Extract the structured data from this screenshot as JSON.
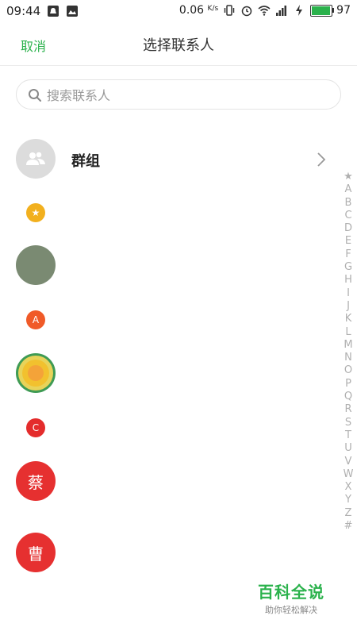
{
  "status_bar": {
    "time": "09:44",
    "net_speed": "0.06",
    "net_unit": "K/s",
    "battery": "97",
    "battery_fraction": 0.97,
    "battery_color": "#2bb24c"
  },
  "header": {
    "cancel_label": "取消",
    "title": "选择联系人"
  },
  "search": {
    "placeholder": "搜索联系人"
  },
  "groups_row": {
    "label": "群组",
    "icon": "people-icon",
    "chevron_icon": "chevron-right-icon"
  },
  "sections": [
    {
      "key": "starred",
      "badge": "★",
      "badge_color": "#f2b01e"
    },
    {
      "key": "A",
      "badge": "A",
      "badge_color": "#f05a28"
    },
    {
      "key": "C",
      "badge": "C",
      "badge_color": "#e42c2c"
    }
  ],
  "contacts": [
    {
      "section": "starred",
      "avatar_type": "photo-pixelated",
      "avatar_text": ""
    },
    {
      "section": "A",
      "avatar_type": "lion-icon",
      "avatar_text": ""
    },
    {
      "section": "C",
      "avatar_type": "letter",
      "avatar_text": "蔡",
      "avatar_color": "#e63030"
    },
    {
      "section": "C",
      "avatar_type": "letter",
      "avatar_text": "曹",
      "avatar_color": "#e63030"
    }
  ],
  "alpha_index": [
    "★",
    "A",
    "B",
    "C",
    "D",
    "E",
    "F",
    "G",
    "H",
    "I",
    "J",
    "K",
    "L",
    "M",
    "N",
    "O",
    "P",
    "Q",
    "R",
    "S",
    "T",
    "U",
    "V",
    "W",
    "X",
    "Y",
    "Z",
    "#"
  ],
  "watermark": {
    "title": "百科全说",
    "subtitle": "助你轻松解决"
  },
  "colors": {
    "accent": "#2bb24c",
    "index_text": "#b0b0b0"
  }
}
